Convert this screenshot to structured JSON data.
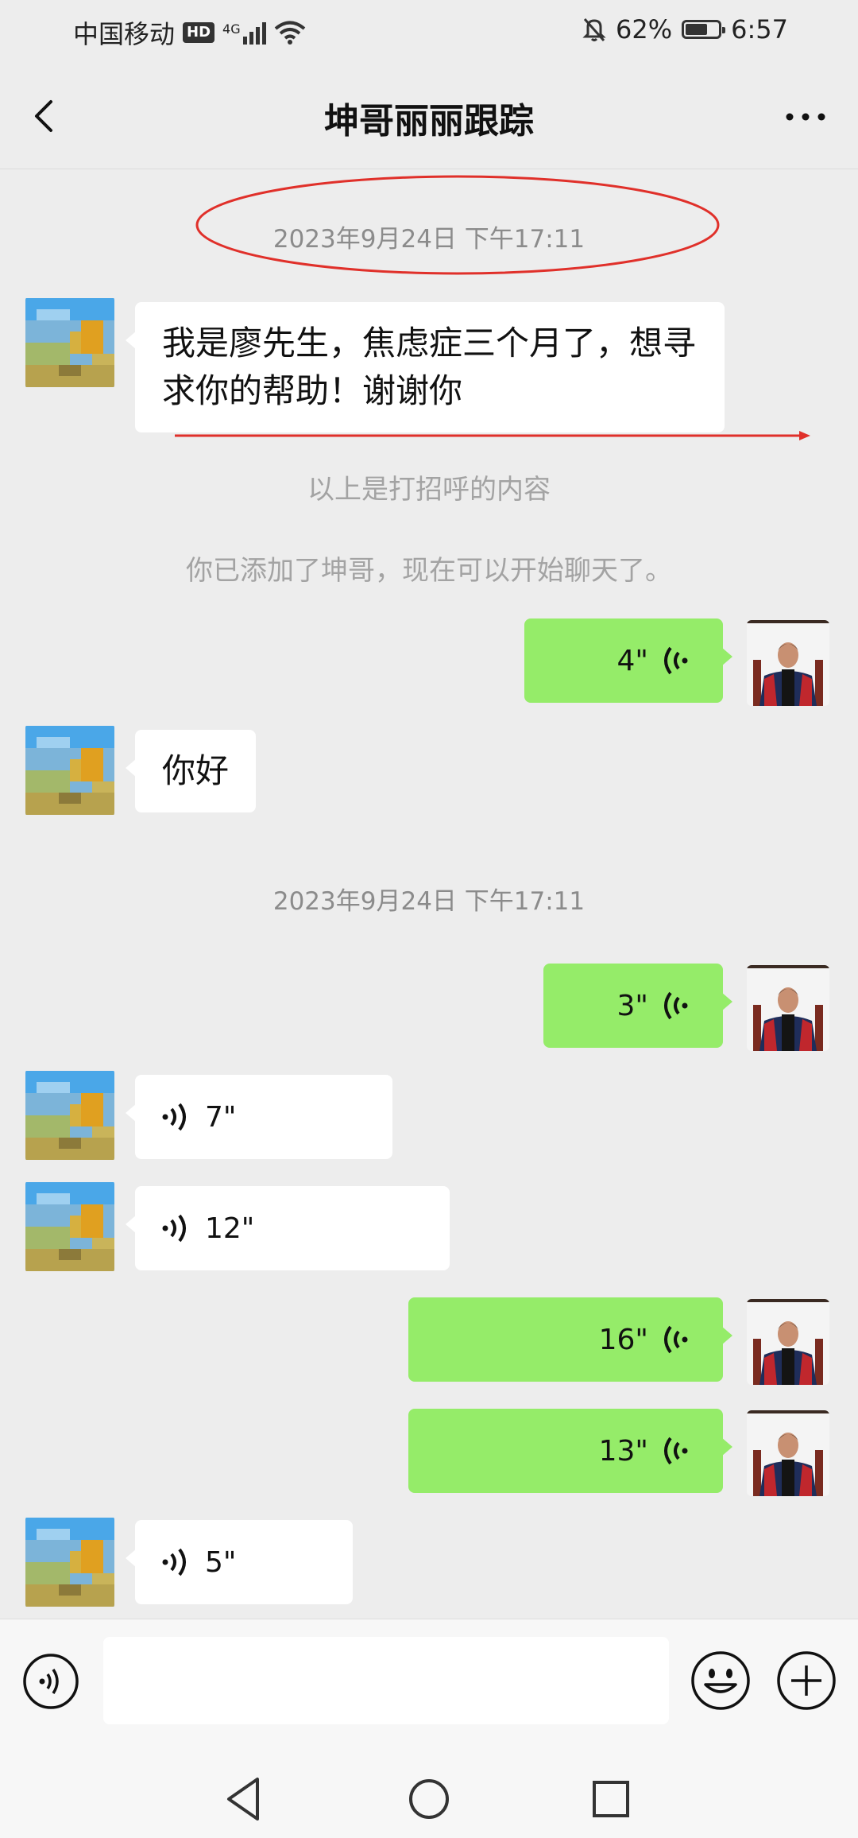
{
  "status_bar": {
    "carrier": "中国移动",
    "hd": "HD",
    "network": "4G",
    "battery_percent": "62%",
    "time": "6:57"
  },
  "nav": {
    "title": "坤哥丽丽跟踪"
  },
  "chat": {
    "timestamp_1": "2023年9月24日 下午17:11",
    "greeting_message": "我是廖先生，焦虑症三个月了，想寻求你的帮助！谢谢你",
    "greeting_note": "以上是打招呼的内容",
    "added_note": "你已添加了坤哥，现在可以开始聊天了。",
    "voice_1_right": "4\"",
    "text_1_left": "你好",
    "timestamp_2": "2023年9月24日 下午17:11",
    "voice_2_right": "3\"",
    "voice_3_left": "7\"",
    "voice_4_left": "12\"",
    "voice_5_right": "16\"",
    "voice_6_right": "13\"",
    "voice_7_left": "5\""
  },
  "input_bar": {
    "value": ""
  },
  "colors": {
    "background": "#ededed",
    "sent_bubble": "#95ec69",
    "received_bubble": "#ffffff",
    "annotation_red": "#e0302a"
  }
}
